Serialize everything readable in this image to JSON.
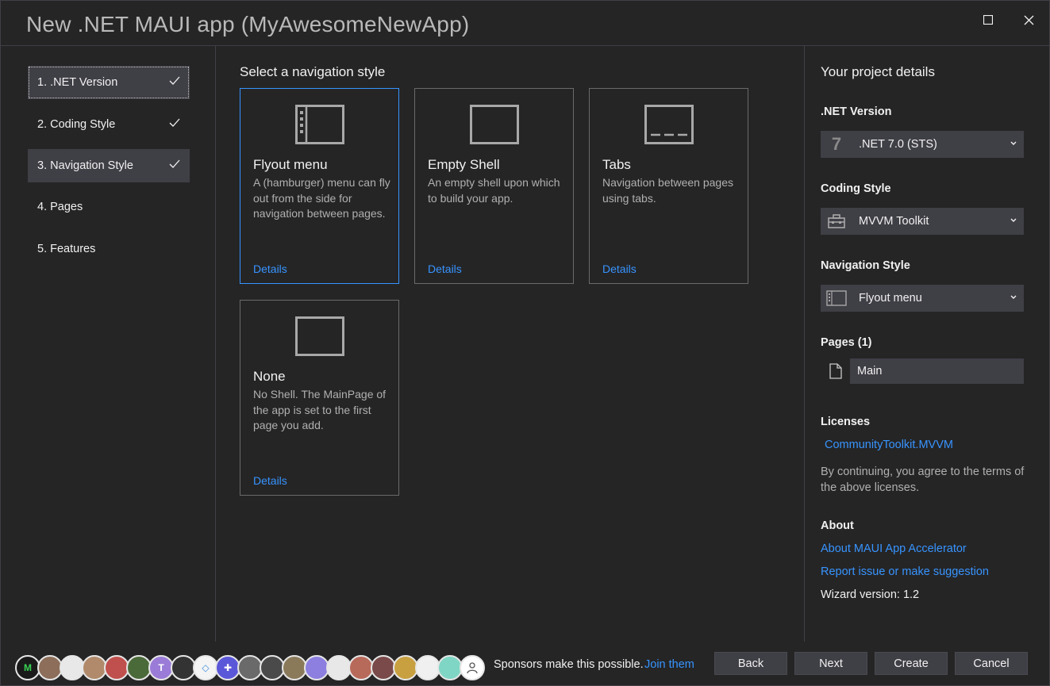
{
  "window": {
    "title": "New .NET MAUI app (MyAwesomeNewApp)"
  },
  "steps": [
    {
      "label": "1. .NET Version",
      "completed": true
    },
    {
      "label": "2. Coding Style",
      "completed": true
    },
    {
      "label": "3. Navigation Style",
      "completed": true
    },
    {
      "label": "4. Pages",
      "completed": false
    },
    {
      "label": "5. Features",
      "completed": false
    }
  ],
  "main": {
    "heading": "Select a navigation style",
    "options": [
      {
        "name": "Flyout menu",
        "description": "A (hamburger) menu can fly out from the side for navigation between pages.",
        "details": "Details",
        "icon": "flyout-menu-icon",
        "selected": true
      },
      {
        "name": "Empty Shell",
        "description": "An empty shell upon which to build your app.",
        "details": "Details",
        "icon": "empty-shell-icon",
        "selected": false
      },
      {
        "name": "Tabs",
        "description": "Navigation between pages using tabs.",
        "details": "Details",
        "icon": "tabs-icon",
        "selected": false
      },
      {
        "name": "None",
        "description": "No Shell. The MainPage of the app is set to the first page you add.",
        "details": "Details",
        "icon": "none-icon",
        "selected": false
      }
    ]
  },
  "details": {
    "title": "Your project details",
    "net_version": {
      "label": ".NET Version",
      "value": ".NET 7.0 (STS)",
      "icon_text": "7"
    },
    "coding_style": {
      "label": "Coding Style",
      "value": "MVVM Toolkit"
    },
    "navigation_style": {
      "label": "Navigation Style",
      "value": "Flyout menu"
    },
    "pages": {
      "label": "Pages (1)",
      "items": [
        "Main"
      ]
    },
    "licenses": {
      "label": "Licenses",
      "link": "CommunityToolkit.MVVM",
      "terms_line1": "By continuing, you agree to the terms of",
      "terms_line2": "the above licenses."
    },
    "about": {
      "label": "About",
      "link1": "About MAUI App Accelerator",
      "link2": "Report issue or make suggestion",
      "version": "Wizard version: 1.2"
    }
  },
  "footer": {
    "sponsor_text": "Sponsors make this possible.",
    "join_link": "Join them",
    "buttons": {
      "back": "Back",
      "next": "Next",
      "create": "Create",
      "cancel": "Cancel"
    }
  },
  "colors": {
    "accent": "#3794ff",
    "background": "#252526",
    "control": "#3f3f46"
  }
}
